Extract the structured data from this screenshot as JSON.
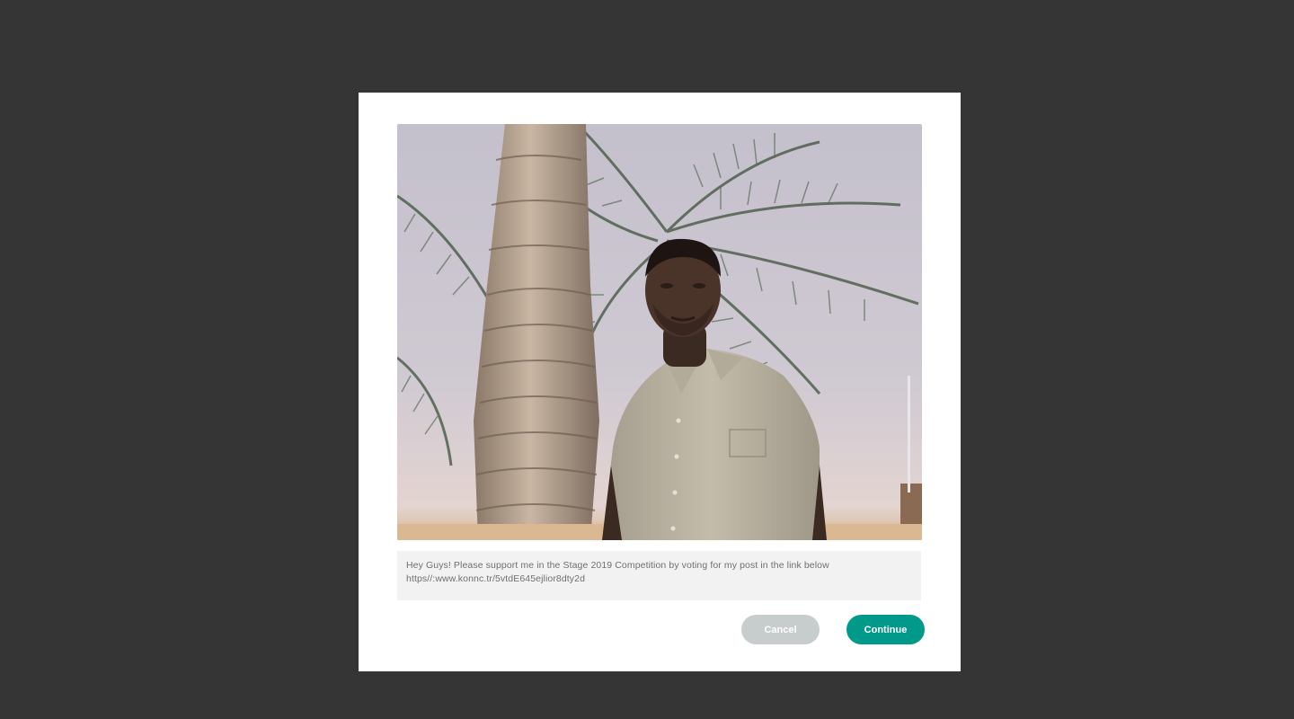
{
  "dialog": {
    "image": {
      "icon": "portrait-photo"
    },
    "caption": {
      "line1": "Hey Guys! Please support me in the Stage 2019 Competition by voting for my post in the link below",
      "line2": "https//:www.konnc.tr/5vtdE645ejlior8dty2d"
    },
    "buttons": {
      "cancel_label": "Cancel",
      "continue_label": "Continue"
    },
    "colors": {
      "backdrop": "#353535",
      "continue": "#00998a",
      "cancel": "#c7cccc"
    }
  }
}
